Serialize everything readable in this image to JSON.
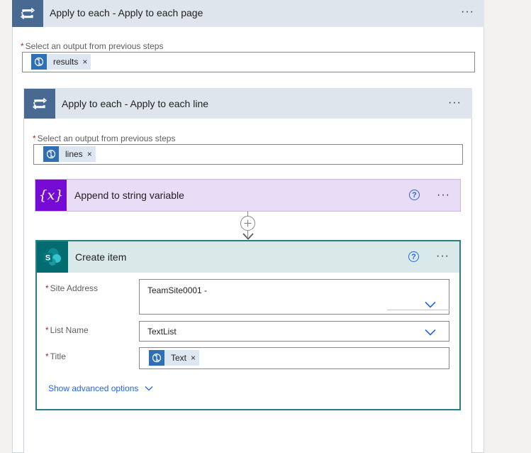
{
  "outer_loop": {
    "title": "Apply to each - Apply to each page",
    "more_glyph": "···",
    "select_label": "Select an output from previous steps",
    "token": "results"
  },
  "inner_loop": {
    "title": "Apply to each - Apply to each line",
    "more_glyph": "···",
    "select_label": "Select an output from previous steps",
    "token": "lines"
  },
  "append_action": {
    "title": "Append to string variable",
    "icon_text": "{x}",
    "help_glyph": "?",
    "more_glyph": "···"
  },
  "create_item": {
    "title": "Create item",
    "icon_text": "S",
    "help_glyph": "?",
    "more_glyph": "···",
    "fields": [
      {
        "label": "Site Address",
        "value": "TeamSite0001 -"
      },
      {
        "label": "List Name",
        "value": "TextList"
      },
      {
        "label": "Title",
        "token": "Text"
      }
    ],
    "advanced_link": "Show advanced options"
  },
  "required_mark": "*",
  "remove_glyph": "×",
  "colors": {
    "loop_header": "#dfe5ec",
    "loop_icon": "#486991",
    "variable_purple": "#770bd6",
    "variable_bg": "#e8dcf7",
    "sharepoint_teal": "#036c70",
    "create_border": "#2d7d82",
    "token_bg": "#dde7f2",
    "token_icon": "#2f6fb5",
    "link_blue": "#2266e3",
    "required_red": "#a4262c"
  },
  "icons": [
    "loop-icon",
    "dynamic-content-icon",
    "variable-icon",
    "sharepoint-icon",
    "help-icon",
    "add-step-icon",
    "chevron-down-icon",
    "arrow-down-icon"
  ]
}
